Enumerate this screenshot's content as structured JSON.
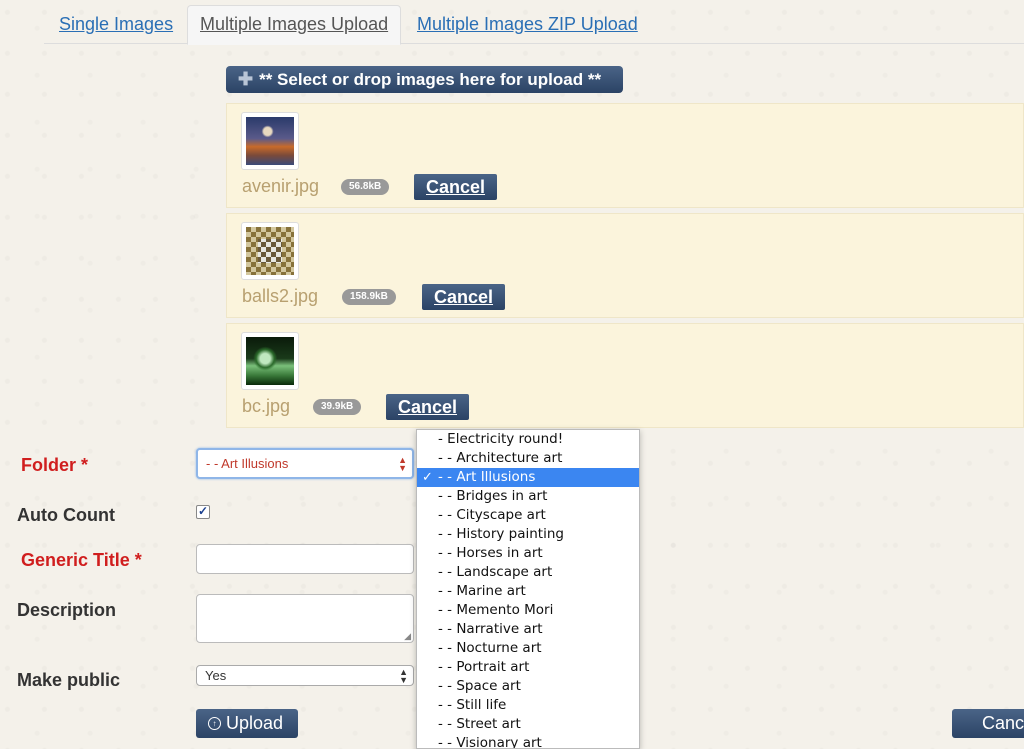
{
  "tabs": [
    {
      "label": "Single Images"
    },
    {
      "label": "Multiple Images Upload"
    },
    {
      "label": "Multiple Images ZIP Upload"
    }
  ],
  "select_button_label": "** Select or drop images here for upload **",
  "files": [
    {
      "name": "avenir.jpg",
      "size": "56.8kB",
      "cancel_label": "Cancel"
    },
    {
      "name": "balls2.jpg",
      "size": "158.9kB",
      "cancel_label": "Cancel"
    },
    {
      "name": "bc.jpg",
      "size": "39.9kB",
      "cancel_label": "Cancel"
    }
  ],
  "form": {
    "folder_label": "Folder",
    "required_mark": "*",
    "folder_value": "- - Art Illusions",
    "auto_count_label": "Auto Count",
    "auto_count_checked": true,
    "generic_title_label": "Generic Title",
    "generic_title_value": "",
    "description_label": "Description",
    "description_value": "",
    "make_public_label": "Make public",
    "make_public_value": "Yes",
    "upload_label": "Upload",
    "cancel_all_label": "Cancel"
  },
  "folder_options": [
    {
      "label": "- Electricity round!",
      "selected": false
    },
    {
      "label": "- - Architecture art",
      "selected": false
    },
    {
      "label": "- - Art Illusions",
      "selected": true
    },
    {
      "label": "- - Bridges in art",
      "selected": false
    },
    {
      "label": "- - Cityscape art",
      "selected": false
    },
    {
      "label": "- - History painting",
      "selected": false
    },
    {
      "label": "- - Horses in art",
      "selected": false
    },
    {
      "label": "- - Landscape art",
      "selected": false
    },
    {
      "label": "- - Marine art",
      "selected": false
    },
    {
      "label": "- - Memento Mori",
      "selected": false
    },
    {
      "label": "- - Narrative art",
      "selected": false
    },
    {
      "label": "- - Nocturne art",
      "selected": false
    },
    {
      "label": "- - Portrait art",
      "selected": false
    },
    {
      "label": "- - Space art",
      "selected": false
    },
    {
      "label": "- - Still life",
      "selected": false
    },
    {
      "label": "- - Street art",
      "selected": false
    },
    {
      "label": "- - Visionary art",
      "selected": false
    }
  ],
  "colors": {
    "button_bg": "#2b4365",
    "link": "#2a6fb5",
    "required_label": "#d01e1e",
    "file_row_bg": "#fbf4dc",
    "selected_option": "#3b86f1"
  }
}
